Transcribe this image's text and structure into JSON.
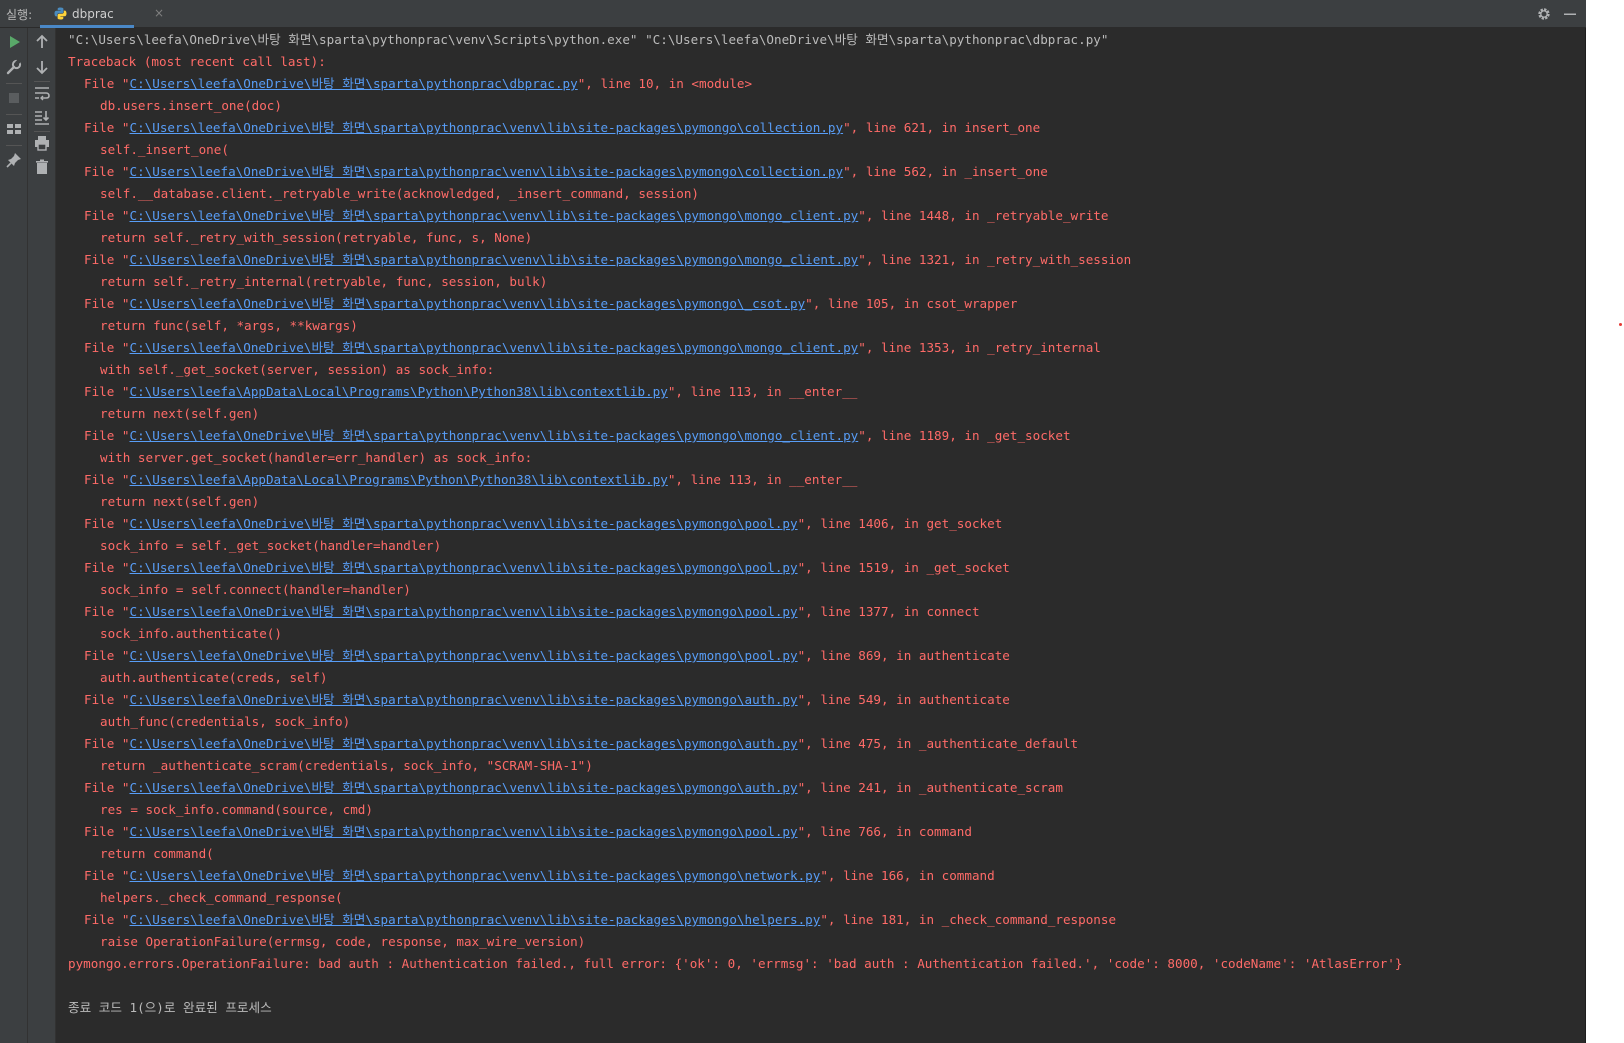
{
  "header": {
    "run_label": "실행:",
    "tab_name": "dbprac",
    "tab_close": "×"
  },
  "toolbar_left": {
    "icons": [
      "run-icon",
      "wrench-icon",
      "stop-icon",
      "layout-icon",
      "pin-icon"
    ]
  },
  "toolbar_second": {
    "icons": [
      "up-arrow-icon",
      "down-arrow-icon",
      "soft-wrap-icon",
      "scroll-to-end-icon",
      "print-icon",
      "trash-icon"
    ]
  },
  "console": {
    "command": "\"C:\\Users\\leefa\\OneDrive\\바탕 화면\\sparta\\pythonprac\\venv\\Scripts\\python.exe\" \"C:\\Users\\leefa\\OneDrive\\바탕 화면\\sparta\\pythonprac\\dbprac.py\"",
    "traceback_header": "Traceback (most recent call last):",
    "frames": [
      {
        "path": "C:\\Users\\leefa\\OneDrive\\바탕 화면\\sparta\\pythonprac\\dbprac.py",
        "suffix": "\", line 10, in <module>",
        "code": "db.users.insert_one(doc)"
      },
      {
        "path": "C:\\Users\\leefa\\OneDrive\\바탕 화면\\sparta\\pythonprac\\venv\\lib\\site-packages\\pymongo\\collection.py",
        "suffix": "\", line 621, in insert_one",
        "code": "self._insert_one("
      },
      {
        "path": "C:\\Users\\leefa\\OneDrive\\바탕 화면\\sparta\\pythonprac\\venv\\lib\\site-packages\\pymongo\\collection.py",
        "suffix": "\", line 562, in _insert_one",
        "code": "self.__database.client._retryable_write(acknowledged, _insert_command, session)"
      },
      {
        "path": "C:\\Users\\leefa\\OneDrive\\바탕 화면\\sparta\\pythonprac\\venv\\lib\\site-packages\\pymongo\\mongo_client.py",
        "suffix": "\", line 1448, in _retryable_write",
        "code": "return self._retry_with_session(retryable, func, s, None)"
      },
      {
        "path": "C:\\Users\\leefa\\OneDrive\\바탕 화면\\sparta\\pythonprac\\venv\\lib\\site-packages\\pymongo\\mongo_client.py",
        "suffix": "\", line 1321, in _retry_with_session",
        "code": "return self._retry_internal(retryable, func, session, bulk)"
      },
      {
        "path": "C:\\Users\\leefa\\OneDrive\\바탕 화면\\sparta\\pythonprac\\venv\\lib\\site-packages\\pymongo\\_csot.py",
        "suffix": "\", line 105, in csot_wrapper",
        "code": "return func(self, *args, **kwargs)"
      },
      {
        "path": "C:\\Users\\leefa\\OneDrive\\바탕 화면\\sparta\\pythonprac\\venv\\lib\\site-packages\\pymongo\\mongo_client.py",
        "suffix": "\", line 1353, in _retry_internal",
        "code": "with self._get_socket(server, session) as sock_info:"
      },
      {
        "path": "C:\\Users\\leefa\\AppData\\Local\\Programs\\Python\\Python38\\lib\\contextlib.py",
        "suffix": "\", line 113, in __enter__",
        "code": "return next(self.gen)"
      },
      {
        "path": "C:\\Users\\leefa\\OneDrive\\바탕 화면\\sparta\\pythonprac\\venv\\lib\\site-packages\\pymongo\\mongo_client.py",
        "suffix": "\", line 1189, in _get_socket",
        "code": "with server.get_socket(handler=err_handler) as sock_info:"
      },
      {
        "path": "C:\\Users\\leefa\\AppData\\Local\\Programs\\Python\\Python38\\lib\\contextlib.py",
        "suffix": "\", line 113, in __enter__",
        "code": "return next(self.gen)"
      },
      {
        "path": "C:\\Users\\leefa\\OneDrive\\바탕 화면\\sparta\\pythonprac\\venv\\lib\\site-packages\\pymongo\\pool.py",
        "suffix": "\", line 1406, in get_socket",
        "code": "sock_info = self._get_socket(handler=handler)"
      },
      {
        "path": "C:\\Users\\leefa\\OneDrive\\바탕 화면\\sparta\\pythonprac\\venv\\lib\\site-packages\\pymongo\\pool.py",
        "suffix": "\", line 1519, in _get_socket",
        "code": "sock_info = self.connect(handler=handler)"
      },
      {
        "path": "C:\\Users\\leefa\\OneDrive\\바탕 화면\\sparta\\pythonprac\\venv\\lib\\site-packages\\pymongo\\pool.py",
        "suffix": "\", line 1377, in connect",
        "code": "sock_info.authenticate()"
      },
      {
        "path": "C:\\Users\\leefa\\OneDrive\\바탕 화면\\sparta\\pythonprac\\venv\\lib\\site-packages\\pymongo\\pool.py",
        "suffix": "\", line 869, in authenticate",
        "code": "auth.authenticate(creds, self)"
      },
      {
        "path": "C:\\Users\\leefa\\OneDrive\\바탕 화면\\sparta\\pythonprac\\venv\\lib\\site-packages\\pymongo\\auth.py",
        "suffix": "\", line 549, in authenticate",
        "code": "auth_func(credentials, sock_info)"
      },
      {
        "path": "C:\\Users\\leefa\\OneDrive\\바탕 화면\\sparta\\pythonprac\\venv\\lib\\site-packages\\pymongo\\auth.py",
        "suffix": "\", line 475, in _authenticate_default",
        "code": "return _authenticate_scram(credentials, sock_info, \"SCRAM-SHA-1\")"
      },
      {
        "path": "C:\\Users\\leefa\\OneDrive\\바탕 화면\\sparta\\pythonprac\\venv\\lib\\site-packages\\pymongo\\auth.py",
        "suffix": "\", line 241, in _authenticate_scram",
        "code": "res = sock_info.command(source, cmd)"
      },
      {
        "path": "C:\\Users\\leefa\\OneDrive\\바탕 화면\\sparta\\pythonprac\\venv\\lib\\site-packages\\pymongo\\pool.py",
        "suffix": "\", line 766, in command",
        "code": "return command("
      },
      {
        "path": "C:\\Users\\leefa\\OneDrive\\바탕 화면\\sparta\\pythonprac\\venv\\lib\\site-packages\\pymongo\\network.py",
        "suffix": "\", line 166, in command",
        "code": "helpers._check_command_response("
      },
      {
        "path": "C:\\Users\\leefa\\OneDrive\\바탕 화면\\sparta\\pythonprac\\venv\\lib\\site-packages\\pymongo\\helpers.py",
        "suffix": "\", line 181, in _check_command_response",
        "code": "raise OperationFailure(errmsg, code, response, max_wire_version)"
      }
    ],
    "file_prefix": "File \"",
    "error": "pymongo.errors.OperationFailure: bad auth : Authentication failed., full error: {'ok': 0, 'errmsg': 'bad auth : Authentication failed.', 'code': 8000, 'codeName': 'AtlasError'}",
    "exit_message": "종료 코드 1(으)로 완료된 프로세스"
  },
  "colors": {
    "background": "#2b2b2b",
    "toolbar": "#3c3f41",
    "error_text": "#ff6b68",
    "link": "#589df6",
    "normal_text": "#bbbbbb",
    "tab_underline": "#4a88c7",
    "run_green": "#59a869"
  }
}
